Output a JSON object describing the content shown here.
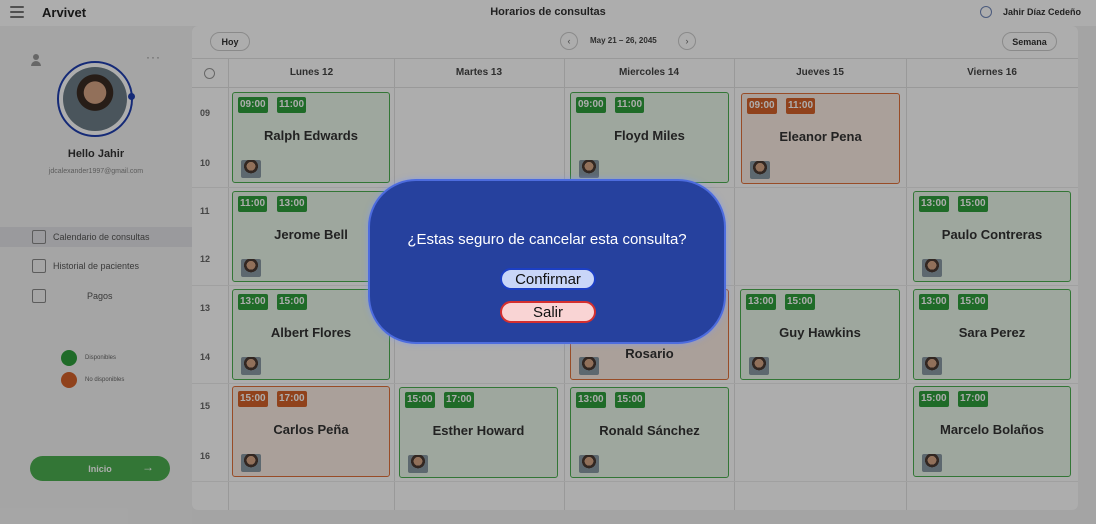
{
  "app_title": "Arvivet",
  "page_title": "Horarios de consultas",
  "user_name": "Jahir Díaz Cedeño",
  "sidebar": {
    "greeting": "Hello Jahir",
    "email": "jdcalexander1997@gmail.com",
    "nav": [
      {
        "label": "Calendario de consultas",
        "icon": "calendar-icon",
        "active": true
      },
      {
        "label": "Historial de pacientes",
        "icon": "patient-record-icon",
        "active": false
      },
      {
        "label": "Pagos",
        "icon": "wallet-icon",
        "active": false
      }
    ],
    "legend": [
      {
        "label": "Disponibles",
        "color": "#2e9e3c"
      },
      {
        "label": "No disponibles",
        "color": "#d4622a"
      }
    ],
    "start_button": "Inicio"
  },
  "toolbar": {
    "today": "Hoy",
    "date_range": "May 21 – 26, 2045",
    "view": "Semana"
  },
  "days": [
    "Lunes 12",
    "Martes 13",
    "Miercoles 14",
    "Jueves 15",
    "Viernes 16"
  ],
  "hours": [
    "09",
    "10",
    "11",
    "12",
    "13",
    "14",
    "15",
    "16"
  ],
  "colors": {
    "available": "#2e9e3c",
    "unavailable": "#d4622a",
    "modal_bg": "#26419e"
  },
  "appointments": [
    {
      "name": "Ralph Edwards",
      "start": "09:00",
      "end": "11:00",
      "day": 0,
      "available": true
    },
    {
      "name": "Jerome Bell",
      "start": "11:00",
      "end": "13:00",
      "day": 0,
      "available": true
    },
    {
      "name": "Albert Flores",
      "start": "13:00",
      "end": "15:00",
      "day": 0,
      "available": true
    },
    {
      "name": "Carlos Peña",
      "start": "15:00",
      "end": "17:00",
      "day": 0,
      "available": false
    },
    {
      "name": "Esther Howard",
      "start": "15:00",
      "end": "17:00",
      "day": 1,
      "available": true
    },
    {
      "name": "Floyd Miles",
      "start": "09:00",
      "end": "11:00",
      "day": 2,
      "available": true
    },
    {
      "name": "Rosario",
      "start": "13:00",
      "end": "15:00",
      "day": 2,
      "available": false
    },
    {
      "name": "Ronald Sánchez",
      "start": "13:00",
      "end": "15:00",
      "day": 2,
      "available": true
    },
    {
      "name": "Eleanor Pena",
      "start": "09:00",
      "end": "11:00",
      "day": 3,
      "available": false
    },
    {
      "name": "Guy Hawkins",
      "start": "13:00",
      "end": "15:00",
      "day": 3,
      "available": true
    },
    {
      "name": "Paulo Contreras",
      "start": "13:00",
      "end": "15:00",
      "day": 4,
      "available": true
    },
    {
      "name": "Sara Perez",
      "start": "13:00",
      "end": "15:00",
      "day": 4,
      "available": true
    },
    {
      "name": "Marcelo Bolaños",
      "start": "15:00",
      "end": "17:00",
      "day": 4,
      "available": true
    }
  ],
  "modal": {
    "question": "¿Estas seguro de cancelar esta consulta?",
    "confirm": "Confirmar",
    "exit": "Salir"
  }
}
